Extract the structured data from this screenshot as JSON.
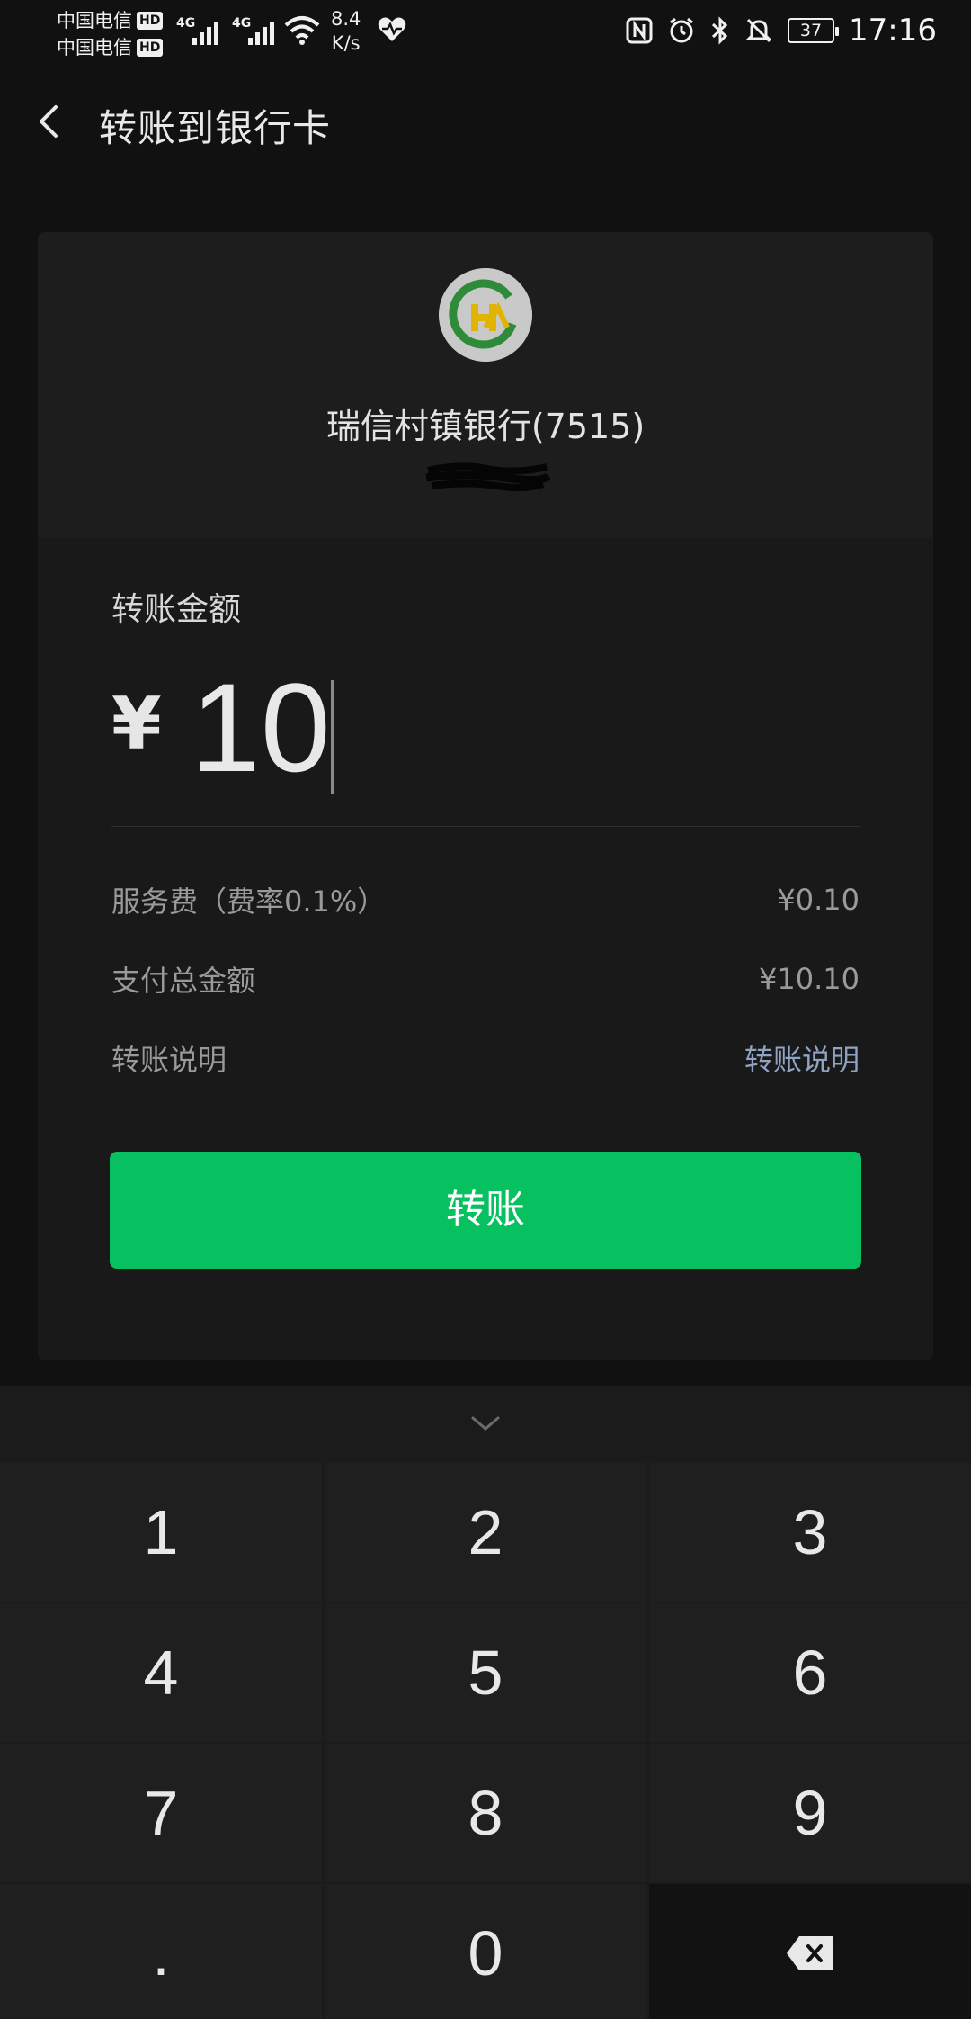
{
  "status_bar": {
    "carrier_1": "中国电信",
    "carrier_2": "中国电信",
    "hd_badge": "HD",
    "network_1": "4G",
    "network_2": "4G",
    "speed_value": "8.4",
    "speed_unit": "K/s",
    "battery": "37",
    "time": "17:16",
    "icons": [
      "nfc-icon",
      "alarm-icon",
      "bluetooth-icon",
      "mute-icon"
    ]
  },
  "header": {
    "title": "转账到银行卡"
  },
  "bank_card": {
    "name": "瑞信村镇银行(7515)"
  },
  "amount": {
    "label": "转账金额",
    "currency": "¥",
    "value": "10"
  },
  "details": {
    "service_fee_label": "服务费（费率0.1%）",
    "service_fee_value": "¥0.10",
    "total_label": "支付总金额",
    "total_value": "¥10.10",
    "note_label": "转账说明",
    "note_link": "转账说明"
  },
  "action": {
    "transfer_label": "转账"
  },
  "keyboard": {
    "keys": [
      "1",
      "2",
      "3",
      "4",
      "5",
      "6",
      "7",
      "8",
      "9",
      ".",
      "0"
    ]
  },
  "colors": {
    "accent": "#07c160",
    "background": "#111111",
    "card": "#191919",
    "link": "#8fa3c2"
  }
}
